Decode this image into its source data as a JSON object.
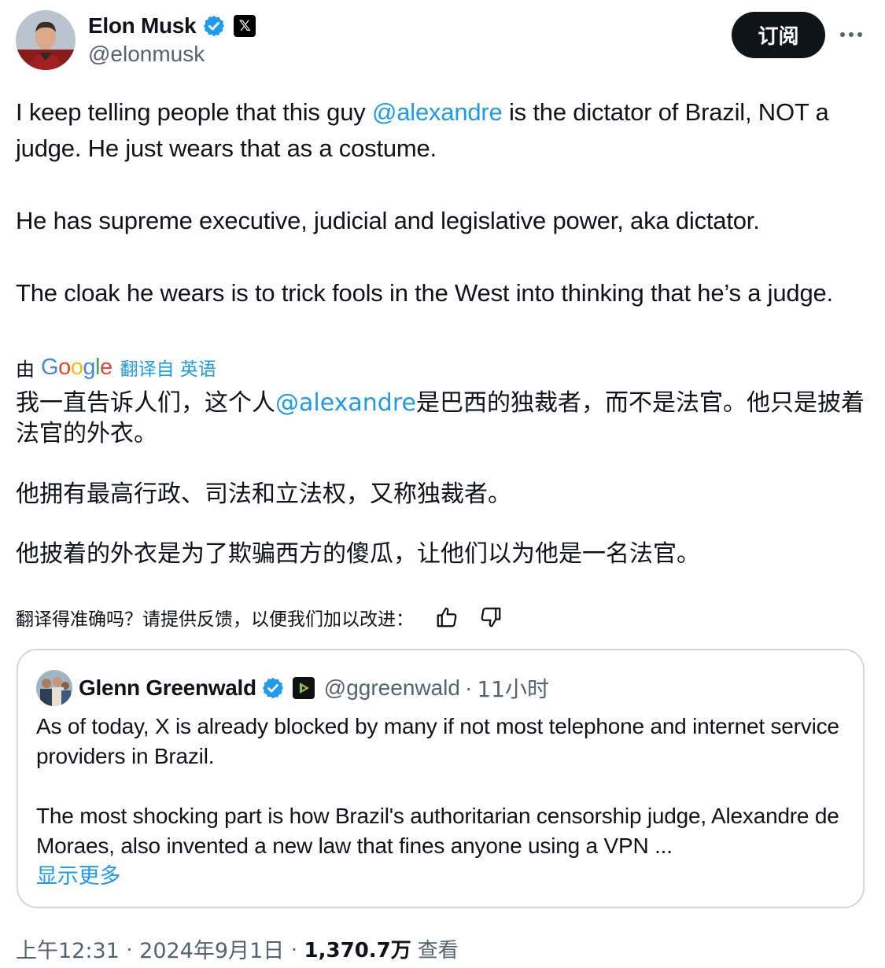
{
  "author": {
    "name": "Elon Musk",
    "handle": "@elonmusk"
  },
  "actions": {
    "subscribe_label": "订阅",
    "more_label": "···"
  },
  "tweet": {
    "p1_before": "I keep telling people that this guy ",
    "p1_mention": "@alexandre",
    "p1_after": " is the dictator of Brazil, NOT a judge. He just wears that as a costume.",
    "p2": "He has supreme executive, judicial and legislative power, aka dictator.",
    "p3": "The cloak he wears is to trick fools in the West into thinking that he’s a judge."
  },
  "translation": {
    "by_label": "由",
    "google_logo": "Google",
    "translated_from": "翻译自 英语",
    "p1_before": "我一直告诉人们，这个人",
    "p1_mention": "@alexandre",
    "p1_after": "是巴西的独裁者，而不是法官。他只是披着法官的外衣。",
    "p2": "他拥有最高行政、司法和立法权，又称独裁者。",
    "p3": "他披着的外衣是为了欺骗西方的傻瓜，让他们以为他是一名法官。",
    "feedback_prompt": "翻译得准确吗？请提供反馈，以便我们加以改进："
  },
  "quote": {
    "name": "Glenn Greenwald",
    "handle": "@ggreenwald",
    "separator": "·",
    "time": "11小时",
    "p1": "As of today, X is already blocked by many if not most telephone and internet service providers in Brazil.",
    "p2": "The most shocking part is how Brazil's authoritarian censorship judge, Alexandre de Moraes, also invented a new law that fines anyone using a VPN ...",
    "show_more": "显示更多"
  },
  "meta": {
    "time": "上午12:31",
    "separator": "·",
    "date": "2024年9月1日",
    "views": "1,370.7万",
    "views_label": "查看"
  },
  "colors": {
    "link": "#1d9bf0",
    "verified": "#1d9bf0",
    "text": "#0f1419",
    "secondary": "#536471",
    "border": "#cfd9de",
    "button": "#0f1419"
  }
}
